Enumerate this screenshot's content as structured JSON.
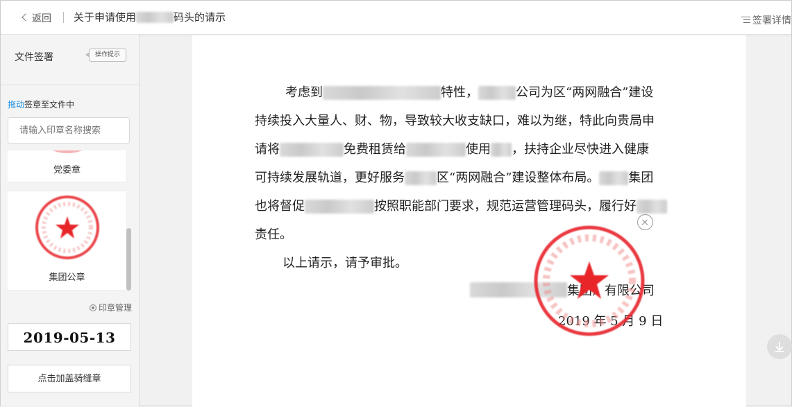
{
  "header": {
    "back_label": "返回",
    "title_prefix": "关于申请使用",
    "title_suffix": "码头的请示",
    "detail_label": "签署详情"
  },
  "sidebar": {
    "title": "文件签署",
    "hint_label": "操作提示",
    "drag_action": "拖动",
    "drag_rest": "签章至文件中",
    "search_placeholder": "请输入印章名称搜索",
    "seals": [
      {
        "name": "党委章"
      },
      {
        "name": "集团公章"
      }
    ],
    "manage_label": "印章管理",
    "date_value": "2019-05-13",
    "ride_seal_button": "点击加盖骑缝章"
  },
  "document": {
    "l1_a": "考虑到",
    "l1_b": "特性，",
    "l1_c": "公司为区“两网融合”建设",
    "l2": "持续投入大量人、财、物，导致较大收支缺口，难以为继，特此向贵局申",
    "l3_a": "请将",
    "l3_b": "免费租赁给",
    "l3_c": "使用",
    "l3_d": "，扶持企业尽快进入健康",
    "l4_a": "可持续发展轨道，更好服务",
    "l4_b": "区“两网融合”建设整体布局。",
    "l4_c": "集团",
    "l5_a": "也将督促",
    "l5_b": "按照职能部门要求，规范运营管理码头，履行好",
    "l6": "责任。",
    "l7": "以上请示，请予审批。",
    "sign_org": "集团）有限公司",
    "sign_date": "2019 年 5 月 9 日"
  },
  "colors": {
    "seal_red": "#e8262c",
    "link_blue": "#1a8fe0"
  }
}
